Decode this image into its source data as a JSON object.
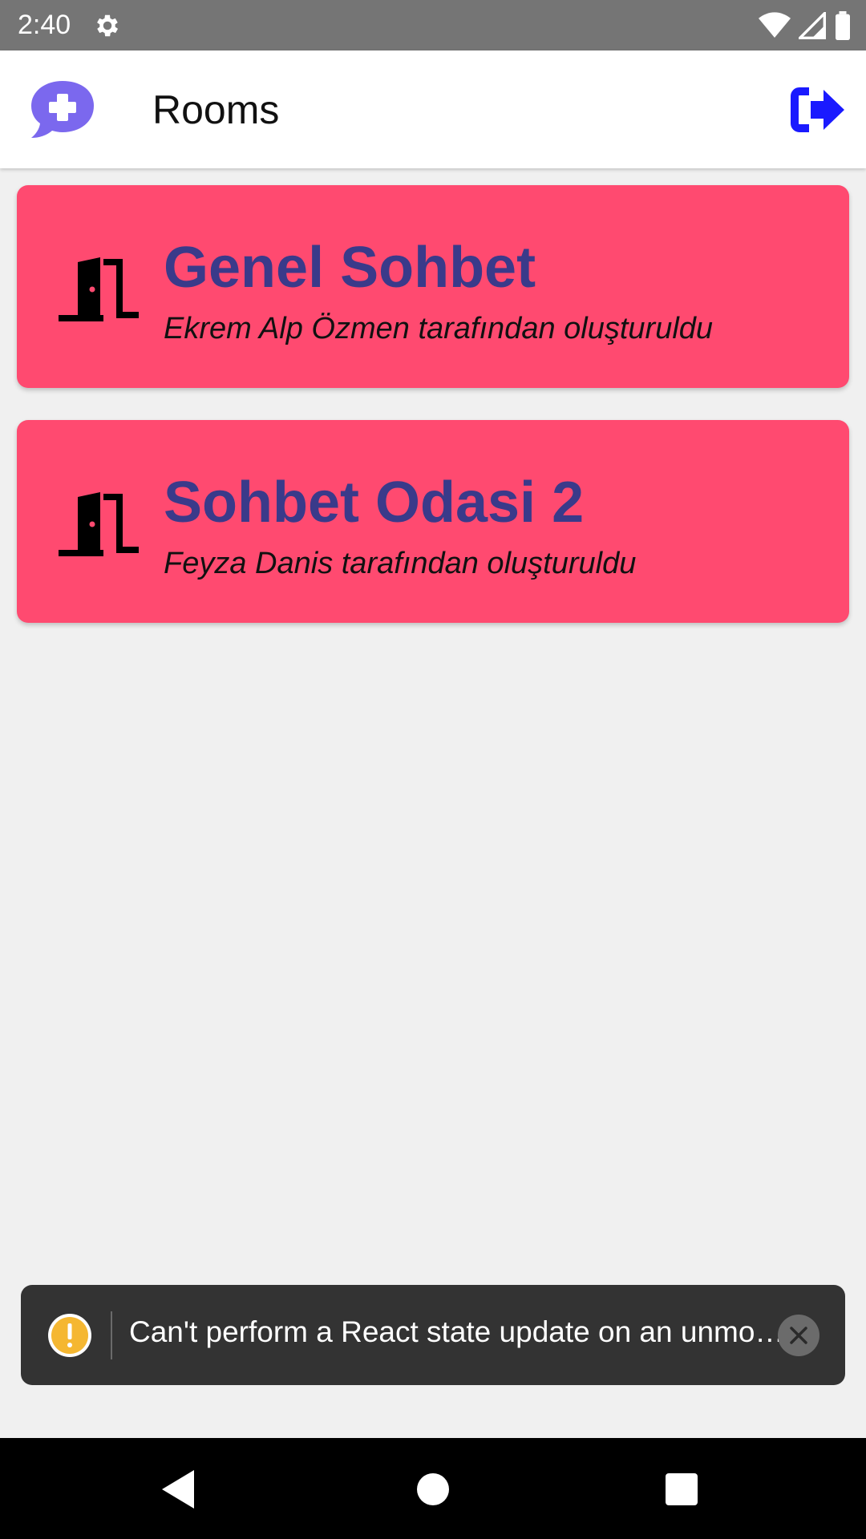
{
  "status_bar": {
    "time": "2:40",
    "icons": [
      "settings-icon",
      "wifi-icon",
      "signal-icon",
      "battery-icon"
    ]
  },
  "app_bar": {
    "title": "Rooms",
    "left_action_icon": "chat-plus-icon",
    "right_action_icon": "logout-icon",
    "colors": {
      "left_icon": "#7b68ee",
      "right_icon": "#1a1aff"
    }
  },
  "rooms": [
    {
      "name": "Genel Sohbet",
      "creator_text": "Ekrem Alp Özmen tarafından oluşturuldu",
      "icon": "door-icon"
    },
    {
      "name": "Sohbet Odasi 2",
      "creator_text": "Feyza Danis tarafından oluşturuldu",
      "icon": "door-icon"
    }
  ],
  "room_style": {
    "card_color": "#ff4a70",
    "title_color": "#3a3a8a"
  },
  "toast": {
    "message": "Can't perform a React state update on an unmo…",
    "icon": "warning-icon",
    "close_icon": "close-icon",
    "warning_color": "#f5b731"
  },
  "nav_bar": {
    "icons": [
      "back-icon",
      "home-icon",
      "recents-icon"
    ]
  }
}
